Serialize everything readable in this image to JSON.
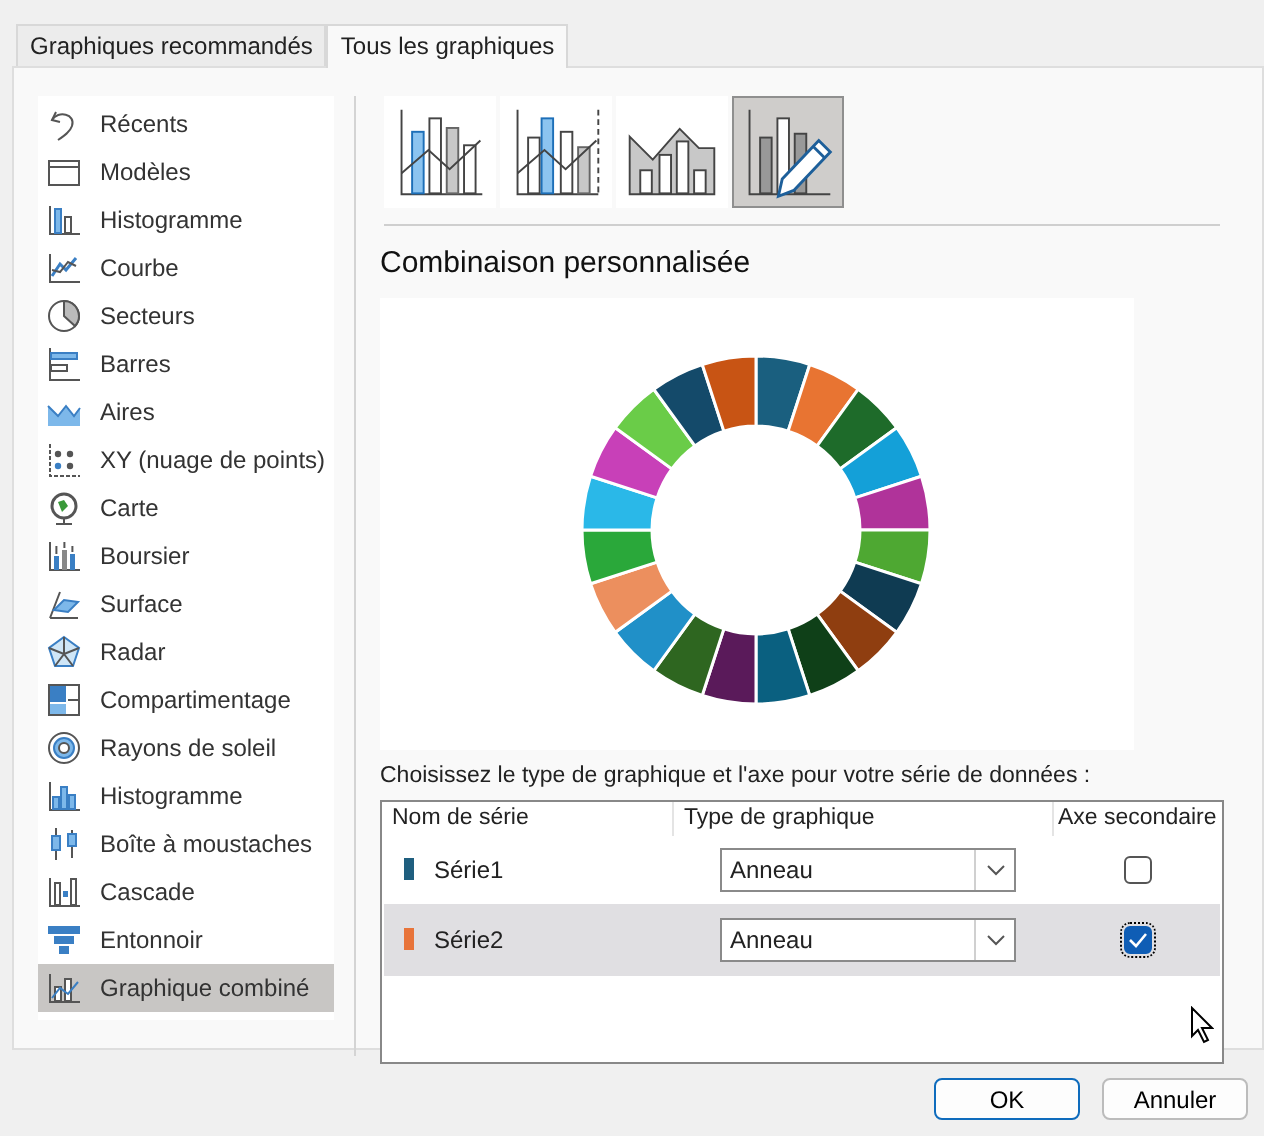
{
  "tabs": [
    {
      "label": "Graphiques recommandés",
      "selected": false
    },
    {
      "label": "Tous les graphiques",
      "selected": true
    }
  ],
  "sidebar": {
    "items": [
      {
        "label": "Récents",
        "selected": false
      },
      {
        "label": "Modèles",
        "selected": false
      },
      {
        "label": "Histogramme",
        "selected": false
      },
      {
        "label": "Courbe",
        "selected": false
      },
      {
        "label": "Secteurs",
        "selected": false
      },
      {
        "label": "Barres",
        "selected": false
      },
      {
        "label": "Aires",
        "selected": false
      },
      {
        "label": "XY (nuage de points)",
        "selected": false
      },
      {
        "label": "Carte",
        "selected": false
      },
      {
        "label": "Boursier",
        "selected": false
      },
      {
        "label": "Surface",
        "selected": false
      },
      {
        "label": "Radar",
        "selected": false
      },
      {
        "label": "Compartimentage",
        "selected": false
      },
      {
        "label": "Rayons de soleil",
        "selected": false
      },
      {
        "label": "Histogramme",
        "selected": false
      },
      {
        "label": "Boîte à moustaches",
        "selected": false
      },
      {
        "label": "Cascade",
        "selected": false
      },
      {
        "label": "Entonnoir",
        "selected": false
      },
      {
        "label": "Graphique combiné",
        "selected": true
      }
    ]
  },
  "subtypes": [
    {
      "selected": false
    },
    {
      "selected": false
    },
    {
      "selected": false
    },
    {
      "selected": true
    }
  ],
  "section_title": "Combinaison personnalisée",
  "instruction": "Choisissez le type de graphique et l'axe pour votre série de données :",
  "table": {
    "columns": [
      "Nom de série",
      "Type de graphique",
      "Axe secondaire"
    ],
    "rows": [
      {
        "name": "Série1",
        "color": "#1f5f7f",
        "chart_type": "Anneau",
        "secondary_axis": false,
        "selected": false
      },
      {
        "name": "Série2",
        "color": "#e8743a",
        "chart_type": "Anneau",
        "secondary_axis": true,
        "selected": true
      }
    ]
  },
  "buttons": [
    {
      "label": "OK",
      "default": true
    },
    {
      "label": "Annuler",
      "default": false
    }
  ]
}
